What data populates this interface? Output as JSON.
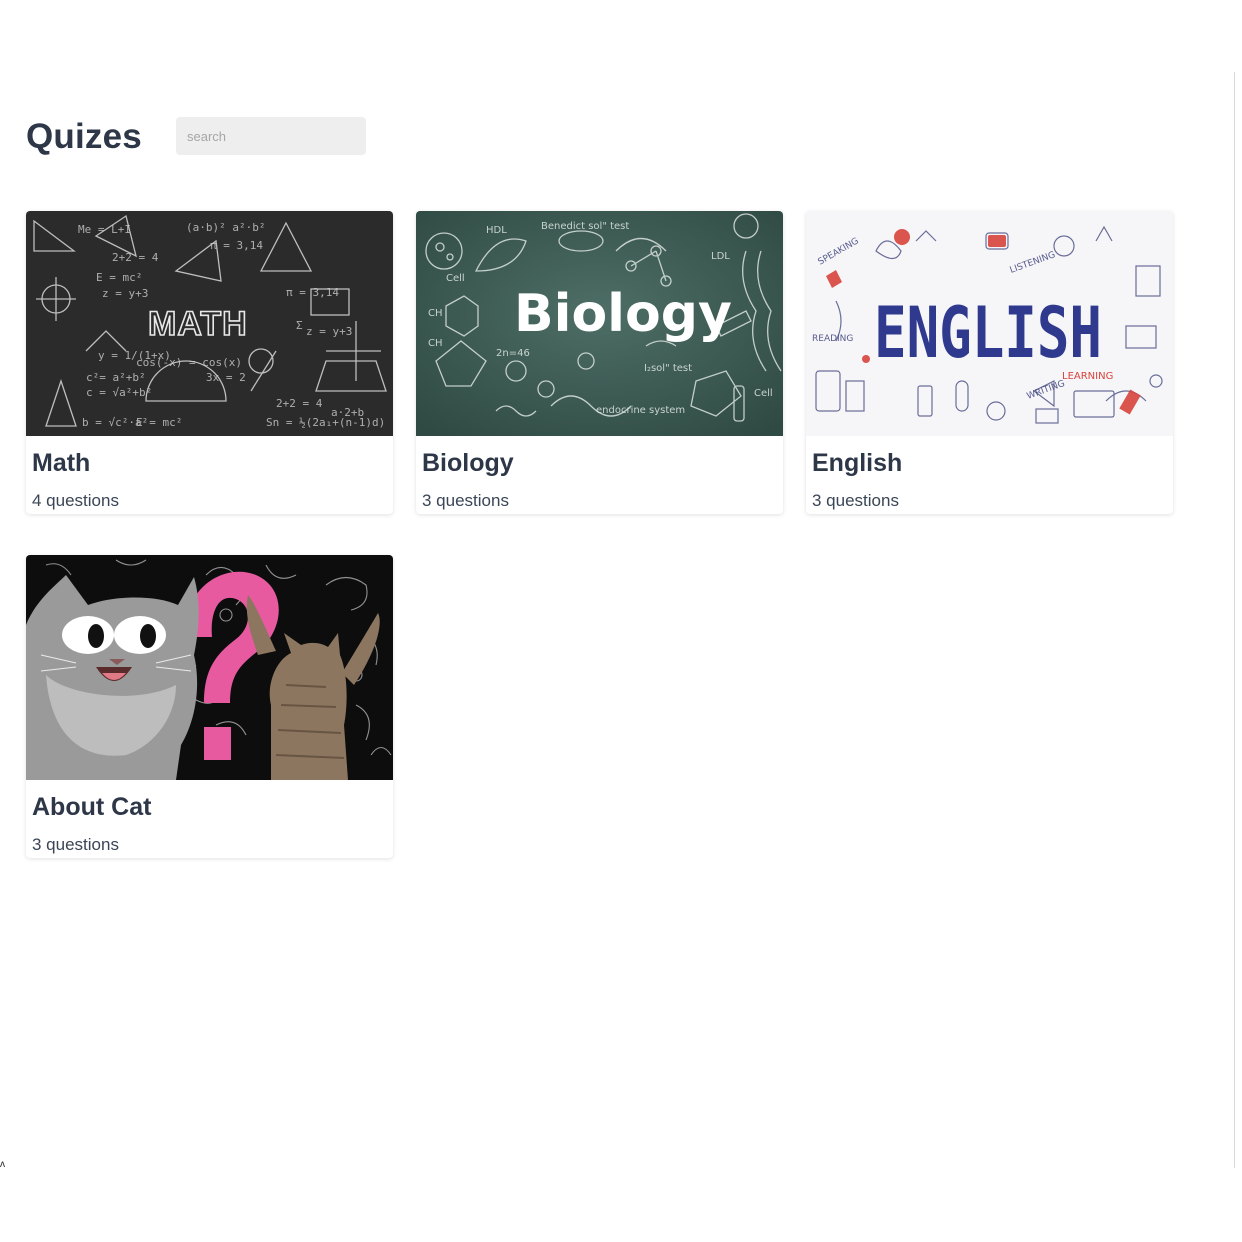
{
  "header": {
    "title": "Quizes",
    "search_placeholder": "search"
  },
  "quizzes": [
    {
      "title": "Math",
      "subtitle": "4 questions",
      "image": "math-chalkboard"
    },
    {
      "title": "Biology",
      "subtitle": "3 questions",
      "image": "biology-chalkboard"
    },
    {
      "title": "English",
      "subtitle": "3 questions",
      "image": "english-doodles"
    },
    {
      "title": "About Cat",
      "subtitle": "3 questions",
      "image": "cat-question-mark"
    }
  ],
  "image_text": {
    "math": "MATH",
    "biology": "Biology",
    "english": "ENGLISH"
  },
  "colors": {
    "heading": "#2d3748",
    "search_bg": "#eeeeee",
    "math_board": "#2b2b2b",
    "biology_board": "#3f5f57",
    "english_letters": "#2f3a8f",
    "english_accent": "#d8433b",
    "cat_pink": "#e85aa0"
  }
}
